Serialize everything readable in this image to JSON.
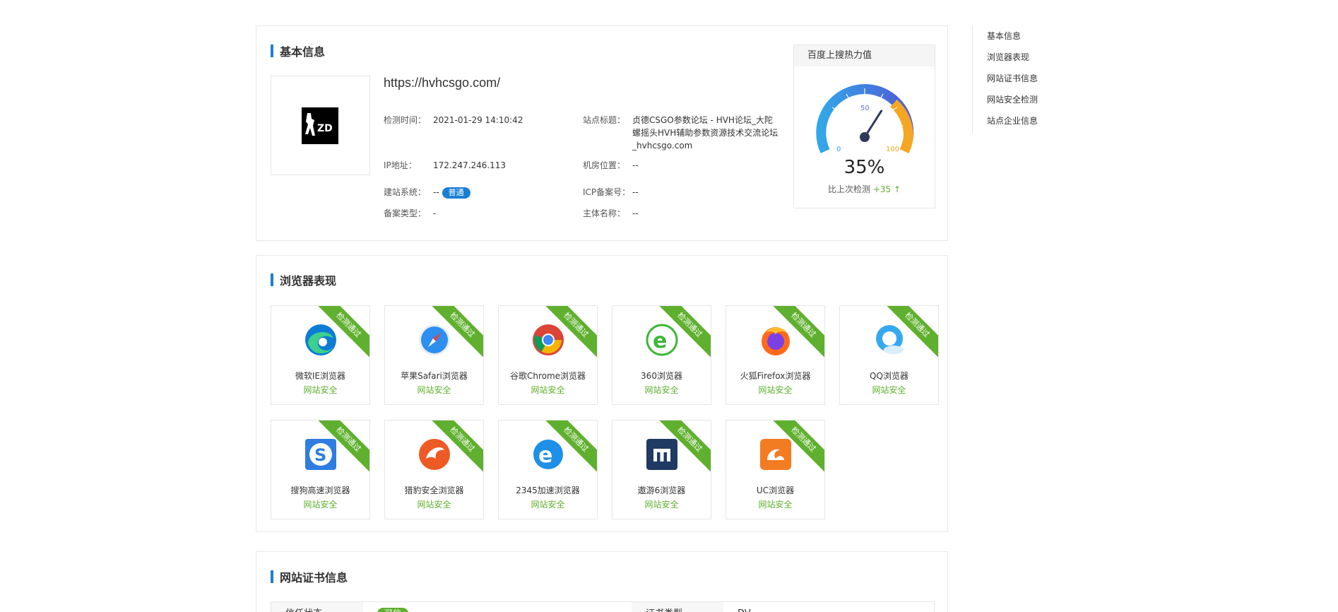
{
  "basic": {
    "title": "基本信息",
    "url": "https://hvhcsgo.com/",
    "logo_text": "ZD",
    "fields": {
      "check_time_label": "检测时间：",
      "check_time": "2021-01-29 14:10:42",
      "site_title_label": "站点标题：",
      "site_title_line1": "贞德CSGO参数论坛 - HVH论坛_大陀",
      "site_title_line2": "螺摇头HVH辅助参数资源技术交流论坛",
      "site_title_line3": "_hvhcsgo.com",
      "ip_label": "IP地址：",
      "ip": "172.247.246.113",
      "room_label": "机房位置：",
      "room": "--",
      "cms_label": "建站系统：",
      "cms": "--",
      "cms_badge": "普通",
      "icp_label": "ICP备案号：",
      "icp": "--",
      "record_type_label": "备案类型：",
      "record_type": "-",
      "owner_label": "主体名称：",
      "owner": "--"
    },
    "gauge": {
      "title": "百度上搜热力值",
      "value": 35,
      "value_text": "35%",
      "tick_min": "0",
      "tick_mid": "50",
      "tick_max": "100",
      "compare_label": "比上次检测",
      "compare_delta": "+35 ↑"
    }
  },
  "browser": {
    "title": "浏览器表现",
    "ribbon": "检测通过",
    "items": [
      {
        "name": "微软IE浏览器",
        "status": "网站安全",
        "icon": "edge-icon"
      },
      {
        "name": "苹果Safari浏览器",
        "status": "网站安全",
        "icon": "safari-icon"
      },
      {
        "name": "谷歌Chrome浏览器",
        "status": "网站安全",
        "icon": "chrome-icon"
      },
      {
        "name": "360浏览器",
        "status": "网站安全",
        "icon": "360-browser-icon"
      },
      {
        "name": "火狐Firefox浏览器",
        "status": "网站安全",
        "icon": "firefox-icon"
      },
      {
        "name": "QQ浏览器",
        "status": "网站安全",
        "icon": "qq-browser-icon"
      },
      {
        "name": "搜狗高速浏览器",
        "status": "网站安全",
        "icon": "sogou-browser-icon"
      },
      {
        "name": "猎豹安全浏览器",
        "status": "网站安全",
        "icon": "liebao-browser-icon"
      },
      {
        "name": "2345加速浏览器",
        "status": "网站安全",
        "icon": "2345-browser-icon"
      },
      {
        "name": "遨游6浏览器",
        "status": "网站安全",
        "icon": "maxthon-icon"
      },
      {
        "name": "UC浏览器",
        "status": "网站安全",
        "icon": "uc-browser-icon"
      }
    ]
  },
  "cert": {
    "title": "网站证书信息",
    "trust_label": "信任状态",
    "trust_value": "可信",
    "type_label": "证书类型",
    "type_value": "DV"
  },
  "nav": {
    "items": [
      "基本信息",
      "浏览器表现",
      "网站证书信息",
      "网站安全检测",
      "站点企业信息"
    ]
  },
  "colors": {
    "accent_blue": "#1a7fd4",
    "success_green": "#5fb02e"
  }
}
